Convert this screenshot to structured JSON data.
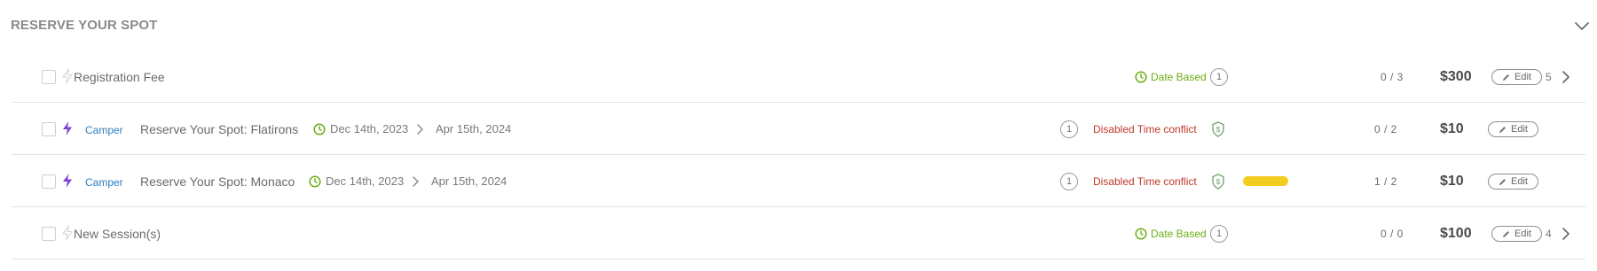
{
  "section": {
    "title": "RESERVE YOUR SPOT"
  },
  "colors": {
    "camper_tag": "#2f7fc0",
    "date_based": "#6cae16",
    "disabled_status": "#c0392b",
    "bolt_active": "#7b3fd4",
    "capacity_bar": "#f2cc1f"
  },
  "items": [
    {
      "name": "Registration Fee",
      "bolt_icon": "bolt-outline-icon",
      "pricing_rule": "Date Based",
      "pricing_rule_count": "1",
      "sold": "0 / 3",
      "price": "$300",
      "edit_label": "Edit",
      "sub_count": "5"
    },
    {
      "tag": "Camper",
      "name": "Reserve Your Spot: Flatirons",
      "bolt_icon": "bolt-filled-icon",
      "date_start": "Dec 14th, 2023",
      "date_end": "Apr 15th, 2024",
      "conflict_count": "1",
      "status": "Disabled Time conflict",
      "sold": "0 / 2",
      "price": "$10",
      "edit_label": "Edit"
    },
    {
      "tag": "Camper",
      "name": "Reserve Your Spot: Monaco",
      "bolt_icon": "bolt-filled-icon",
      "date_start": "Dec 14th, 2023",
      "date_end": "Apr 15th, 2024",
      "conflict_count": "1",
      "status": "Disabled Time conflict",
      "sold": "1 / 2",
      "price": "$10",
      "edit_label": "Edit"
    },
    {
      "name": "New Session(s)",
      "bolt_icon": "bolt-outline-icon",
      "pricing_rule": "Date Based",
      "pricing_rule_count": "1",
      "sold": "0 / 0",
      "price": "$100",
      "edit_label": "Edit",
      "sub_count": "4"
    }
  ]
}
